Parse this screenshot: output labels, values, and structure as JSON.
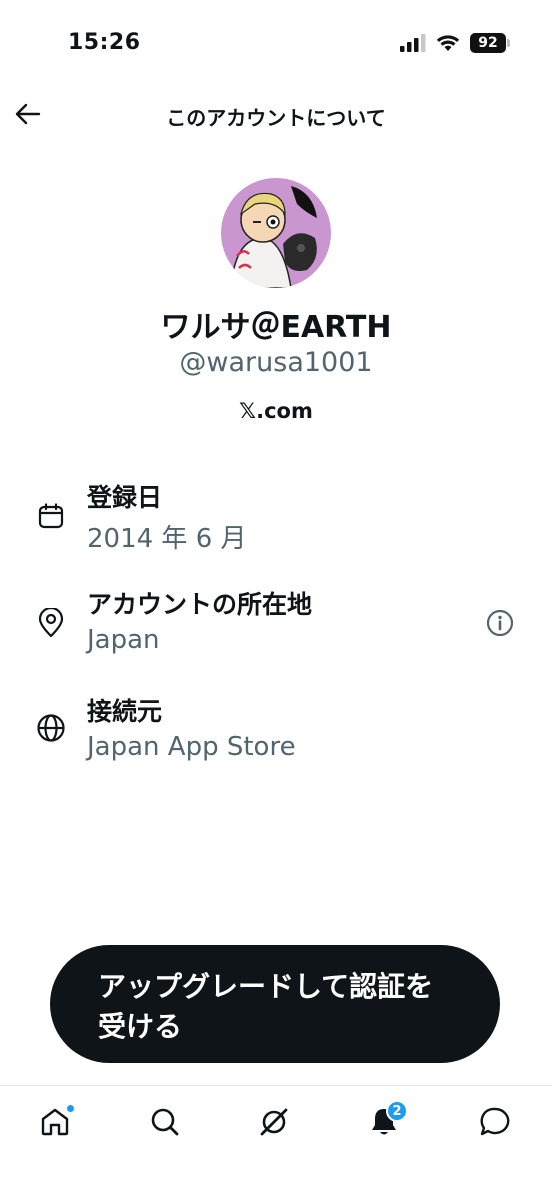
{
  "status_bar": {
    "time": "15:26",
    "battery": "92"
  },
  "header": {
    "title": "このアカウントについて"
  },
  "profile": {
    "display_name": "ワルサ＠EARTH",
    "handle": "@warusa1001",
    "source_site": "𝕏.com"
  },
  "info": {
    "joined": {
      "label": "登録日",
      "value": "2014 年 6 月",
      "icon": "calendar-icon"
    },
    "location": {
      "label": "アカウントの所在地",
      "value": "Japan",
      "icon": "location-pin-icon"
    },
    "connected_via": {
      "label": "接続元",
      "value": "Japan App Store",
      "icon": "globe-icon"
    }
  },
  "upgrade_button": {
    "label": "アップグレードして認証を受ける"
  },
  "tab_bar": {
    "notifications_count": "2"
  },
  "colors": {
    "text_primary": "#0f1419",
    "text_secondary": "#536471",
    "accent": "#1d9bf0",
    "button_bg": "#0f1419"
  }
}
